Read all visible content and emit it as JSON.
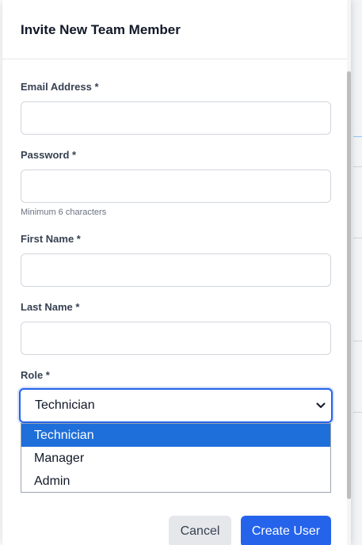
{
  "modal": {
    "title": "Invite New Team Member"
  },
  "form": {
    "email": {
      "label": "Email Address *",
      "value": "",
      "placeholder": ""
    },
    "password": {
      "label": "Password *",
      "value": "",
      "placeholder": "",
      "hint": "Minimum 6 characters"
    },
    "first_name": {
      "label": "First Name *",
      "value": "",
      "placeholder": ""
    },
    "last_name": {
      "label": "Last Name *",
      "value": "",
      "placeholder": ""
    },
    "role": {
      "label": "Role *",
      "selected": "Technician",
      "options": [
        "Technician",
        "Manager",
        "Admin"
      ]
    }
  },
  "buttons": {
    "cancel": "Cancel",
    "create": "Create User"
  },
  "icons": {
    "select_chevron": "chevron-down-icon"
  },
  "colors": {
    "accent": "#2563eb",
    "selected_option": "#1e6fd9"
  }
}
